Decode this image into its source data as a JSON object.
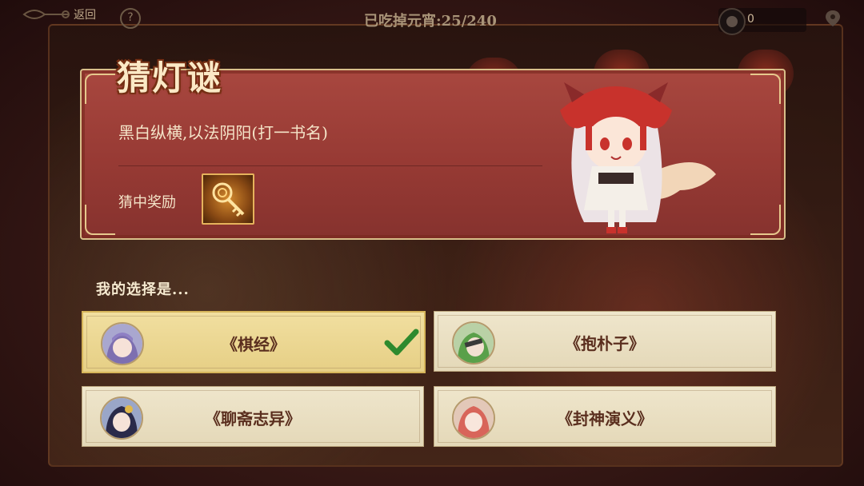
{
  "topbar": {
    "back_label": "返回",
    "help_label": "?",
    "counter": "已吃掉元宵:25/240",
    "currency_count": "0"
  },
  "riddle": {
    "title": "猜灯谜",
    "question": "黑白纵横,以法阴阳(打一书名)",
    "reward_label": "猜中奖励",
    "reward_icon": "golden-key-icon"
  },
  "choices": {
    "prompt": "我的选择是...",
    "options": [
      {
        "label": "《棋经》",
        "selected": true
      },
      {
        "label": "《抱朴子》",
        "selected": false
      },
      {
        "label": "《聊斋志异》",
        "selected": false
      },
      {
        "label": "《封神演义》",
        "selected": false
      }
    ]
  },
  "colors": {
    "panel_red": "#a8473f",
    "gold_border": "#d9bf8a",
    "check_green": "#2e8a2e"
  }
}
